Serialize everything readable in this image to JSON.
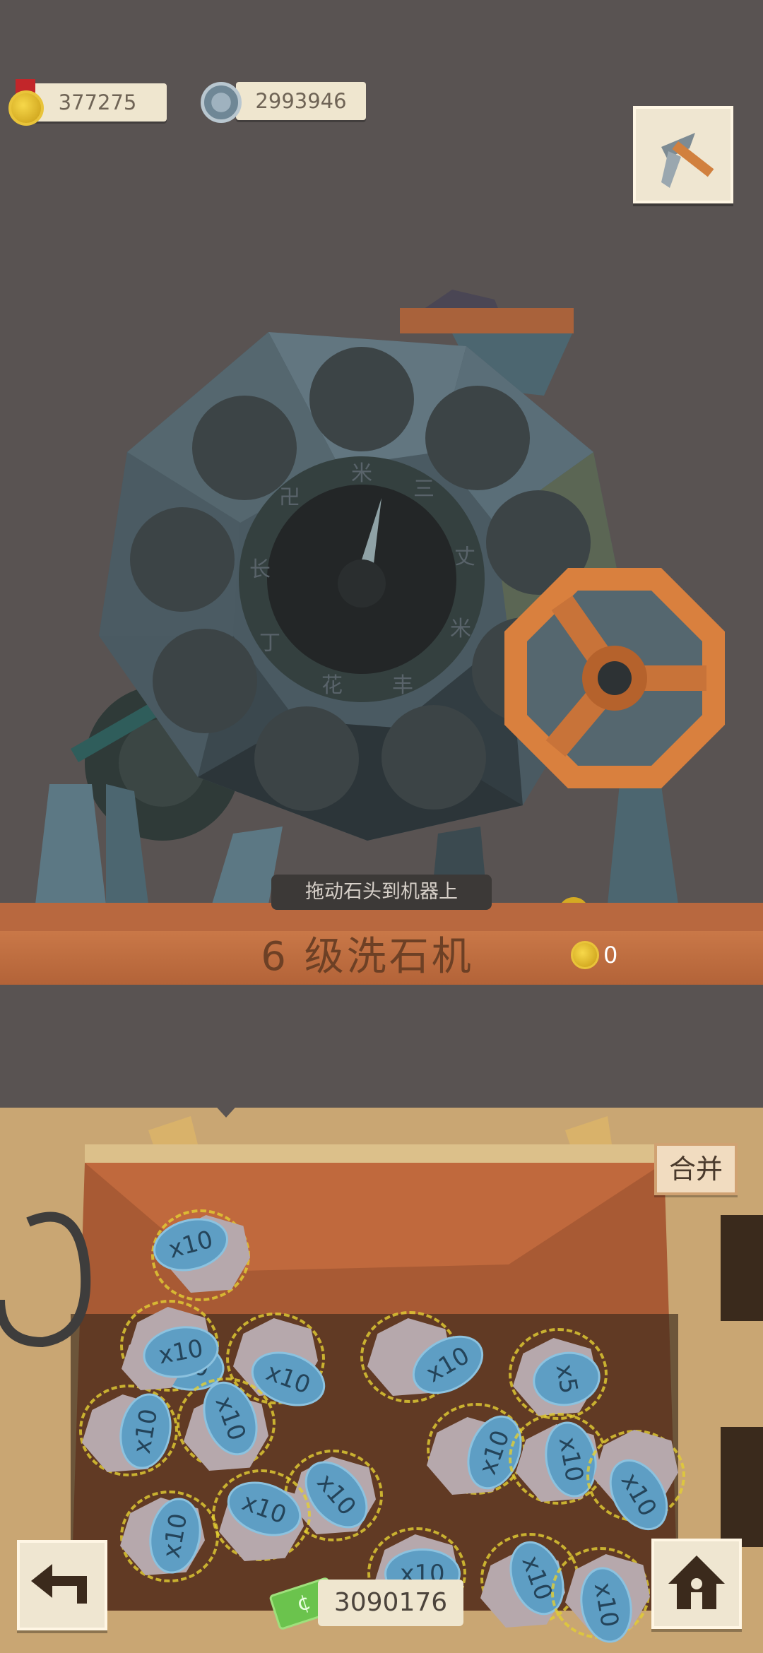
{
  "hud": {
    "medals": "377275",
    "gears": "2993946",
    "pickaxe_icon": "pickaxe-icon"
  },
  "machine": {
    "drag_hint": "拖动石头到机器上",
    "title": "6 级洗石机",
    "reward_value": "0"
  },
  "panel": {
    "merge_label": "合并",
    "cash_value": "3090176",
    "cash_symbol": "¢",
    "back_icon": "back-arrow-icon",
    "home_icon": "home-icon",
    "stones": [
      {
        "label": "x10"
      },
      {
        "label": "x10"
      },
      {
        "label": "x10"
      },
      {
        "label": "x10"
      },
      {
        "label": "x5"
      },
      {
        "label": "x10"
      },
      {
        "label": "x10"
      },
      {
        "label": "x10"
      },
      {
        "label": "x10"
      },
      {
        "label": "x10"
      },
      {
        "label": "x10"
      },
      {
        "label": "x10"
      },
      {
        "label": "x10"
      },
      {
        "label": "x10"
      },
      {
        "label": "x10"
      },
      {
        "label": "x10"
      },
      {
        "label": "x10"
      }
    ]
  },
  "colors": {
    "background": "#595352",
    "panel": "#c9a673",
    "wood": "#b8683f",
    "wheel": "#d9803e"
  }
}
